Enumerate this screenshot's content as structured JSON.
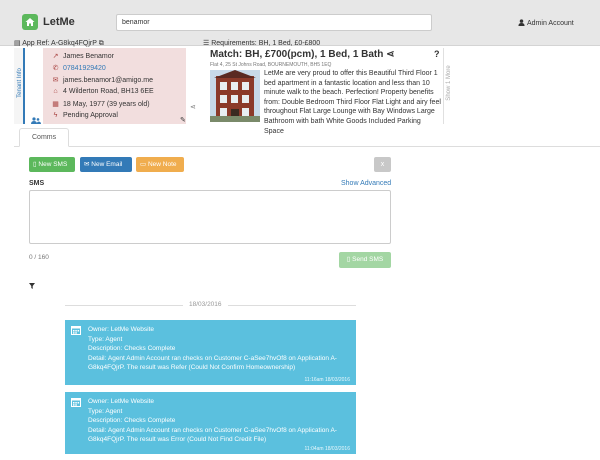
{
  "nav": {
    "brand": "LetMe",
    "search_value": "benamor",
    "account": "Admin Account"
  },
  "header": {
    "app_ref": "App Ref: A-G8kq4FQjrP",
    "requirements": "Requirements: BH, 1 Bed, £0-£800"
  },
  "tenant": {
    "tab_label": "Tenant Info",
    "name": "James Benamor",
    "phone": "07841929420",
    "email": "james.benamor1@amigo.me",
    "address": "4 Wilderton Road, BH13 6EE",
    "dob": "18 May, 1977 (39 years old)",
    "status": "Pending Approval"
  },
  "match": {
    "title": "Match: BH, £700(pcm), 1 Bed, 1 Bath",
    "question": "?",
    "address": "Flat 4, 25 St Johns Road, BOURNEMOUTH, BH5 1EQ",
    "description": "LetMe are very proud to offer this Beautiful Third Floor 1 bed apartment in a fantastic location and less than 10 minute walk to the beach. Perfection! Property benefits from: Double Bedroom Third Floor Flat Light and airy feel throughout Flat Large Lounge with Bay Windows Large Bathroom with bath White Goods Included Parking Space",
    "show_more": "Show 1 More"
  },
  "tabs": [
    "Comms"
  ],
  "comms": {
    "new_sms": "New SMS",
    "new_email": "New Email",
    "new_note": "New Note",
    "close": "x",
    "sms_label": "SMS",
    "show_advanced": "Show Advanced",
    "sms_value": "",
    "char_count": "0 / 160",
    "send": "Send SMS"
  },
  "timeline": {
    "date": "18/03/2016",
    "notes": [
      {
        "owner": "Owner: LetMe Website",
        "type": "Type: Agent",
        "description": "Description: Checks Complete",
        "detail": "Detail: Agent Admin Account ran checks on Customer C-aSee7hvOf8 on Application A-G8kq4FQjrP. The result was Refer (Could Not Confirm Homeownership)",
        "footer": "11:16am 18/03/2016"
      },
      {
        "owner": "Owner: LetMe Website",
        "type": "Type: Agent",
        "description": "Description: Checks Complete",
        "detail": "Detail: Agent Admin Account ran checks on Customer C-aSee7hvOf8 on Application A-G8kq4FQjrP. The result was Error (Could Not Find Credit File)",
        "footer": "11:04am 18/03/2016"
      }
    ]
  },
  "colors": {
    "brand": "#5cb85c",
    "primary": "#337ab7",
    "warning": "#f0ad4e",
    "info": "#5bc0de",
    "contact_bg": "#f2dede"
  }
}
